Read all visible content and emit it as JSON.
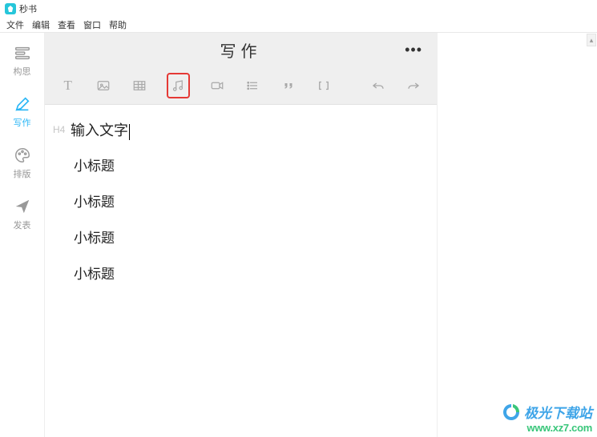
{
  "app": {
    "name": "秒书"
  },
  "menus": [
    "文件",
    "编辑",
    "查看",
    "窗口",
    "帮助"
  ],
  "sidebar": {
    "items": [
      {
        "label": "构思"
      },
      {
        "label": "写作"
      },
      {
        "label": "排版"
      },
      {
        "label": "发表"
      }
    ]
  },
  "editor": {
    "title": "写作",
    "more": "•••",
    "toolbar": {
      "text": "T",
      "image": "image",
      "table": "table",
      "music": "music",
      "video": "video",
      "list": "list",
      "quote": "quote",
      "bracket": "bracket",
      "undo": "undo",
      "redo": "redo"
    },
    "content": {
      "h4_prefix": "H4",
      "first_line": "输入文字",
      "sub_lines": [
        "小标题",
        "小标题",
        "小标题",
        "小标题"
      ]
    }
  },
  "watermark": {
    "title": "极光下载站",
    "url": "www.xz7.com"
  }
}
